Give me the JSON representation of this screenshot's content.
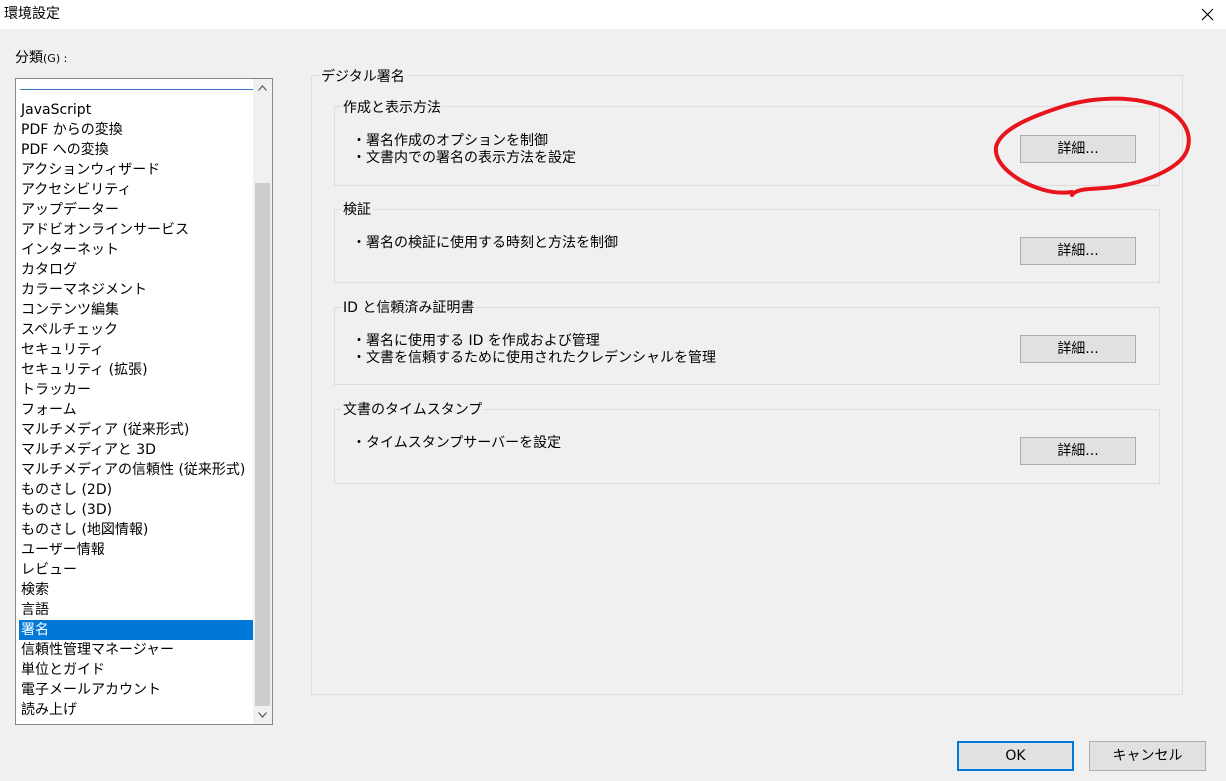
{
  "window": {
    "title": "環境設定",
    "close_icon": "close-icon"
  },
  "categories": {
    "label": "分類",
    "accelerator": "(G) :",
    "selected_index": 26,
    "items": [
      "JavaScript",
      "PDF からの変換",
      "PDF への変換",
      "アクションウィザード",
      "アクセシビリティ",
      "アップデーター",
      "アドビオンラインサービス",
      "インターネット",
      "カタログ",
      "カラーマネジメント",
      "コンテンツ編集",
      "スペルチェック",
      "セキュリティ",
      "セキュリティ (拡張)",
      "トラッカー",
      "フォーム",
      "マルチメディア (従来形式)",
      "マルチメディアと 3D",
      "マルチメディアの信頼性 (従来形式)",
      "ものさし (2D)",
      "ものさし (3D)",
      "ものさし (地図情報)",
      "ユーザー情報",
      "レビュー",
      "検索",
      "言語",
      "署名",
      "信頼性管理マネージャー",
      "単位とガイド",
      "電子メールアカウント",
      "読み上げ"
    ]
  },
  "panel": {
    "title": "デジタル署名",
    "groups": [
      {
        "title": "作成と表示方法",
        "bullets": [
          "・署名作成のオプションを制御",
          "・文書内での署名の表示方法を設定"
        ],
        "button": "詳細..."
      },
      {
        "title": "検証",
        "bullets": [
          "・署名の検証に使用する時刻と方法を制御"
        ],
        "button": "詳細..."
      },
      {
        "title": "ID と信頼済み証明書",
        "bullets": [
          "・署名に使用する ID を作成および管理",
          "・文書を信頼するために使用されたクレデンシャルを管理"
        ],
        "button": "詳細..."
      },
      {
        "title": "文書のタイムスタンプ",
        "bullets": [
          "・タイムスタンプサーバーを設定"
        ],
        "button": "詳細..."
      }
    ]
  },
  "footer": {
    "ok": "OK",
    "cancel": "キャンセル"
  },
  "colors": {
    "accent": "#0078d7",
    "annotation": "#e8141c"
  }
}
